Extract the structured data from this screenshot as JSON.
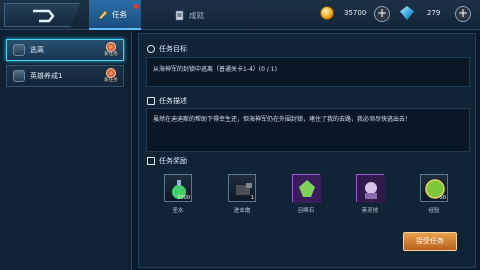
{
  "topbar": {
    "tabs": [
      {
        "label": "任务",
        "active": true,
        "notify": true
      },
      {
        "label": "成就",
        "active": false,
        "notify": false
      }
    ],
    "resources": [
      {
        "icon": "gold-coin-icon",
        "value": "35700"
      },
      {
        "icon": "diamond-gem-icon",
        "value": "279"
      }
    ]
  },
  "quests": [
    {
      "name": "逃离",
      "badge": "新任务",
      "active": true
    },
    {
      "name": "英雄养成1",
      "badge": "新任务",
      "active": false
    }
  ],
  "detail": {
    "goal_title": "任务目标",
    "goal_text": "从海神军的封锁中逃离（普通关卡1-4）(0 / 1)",
    "desc_title": "任务描述",
    "desc_text": "虽然在迪迪斯的帮助下得幸生还，但海神军仍在外围封锁，堵住了我的去路，我必须尽快逃出去！",
    "reward_title": "任务奖励",
    "rewards": [
      {
        "name": "圣水",
        "count": "5000",
        "icon": "potion-flask-icon"
      },
      {
        "name": "进击炮",
        "count": "1",
        "icon": "cannon-icon"
      },
      {
        "name": "召唤石",
        "count": "",
        "icon": "summon-stone-icon"
      },
      {
        "name": "英灵技",
        "count": "",
        "icon": "hero-spirit-icon"
      },
      {
        "name": "经验",
        "count": "50",
        "icon": "exp-orb-icon"
      }
    ],
    "accept_label": "接受任务"
  },
  "colors": {
    "accent": "#5fc0ff",
    "active_border": "#4ad2f0",
    "button": "#d38536",
    "badge": "#b8321d"
  }
}
